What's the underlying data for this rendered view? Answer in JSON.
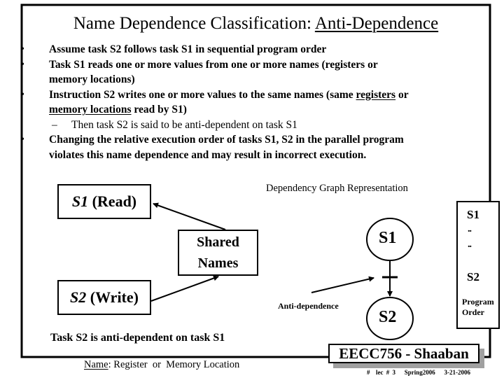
{
  "slide": {
    "title_prefix": "Name Dependence Classification: ",
    "title_emphasis": "Anti-Dependence",
    "bullets": [
      {
        "line1": "Assume  task S2 follows task S1 in sequential program order"
      },
      {
        "line1": "Task S1  reads one or more values from one or more names (registers or",
        "line2": "memory locations)"
      },
      {
        "line1_a": "Instruction  S2  writes one or more  values to the same  names (same ",
        "line1_u": "registers",
        "line1_b": " or",
        "line2_u": "memory locations",
        "line2_b": "  read by S1)",
        "sub": "Then task S2 is said to be anti-dependent on task S1"
      },
      {
        "line1": "Changing the relative execution order of tasks S1, S2  in the parallel program",
        "line2": "violates this name dependence and may result in  incorrect execution."
      }
    ],
    "bullet_glyph": "•",
    "sub_glyph": "–"
  },
  "diagram": {
    "s1_read": {
      "italic": "S1",
      "rest": " (Read)"
    },
    "s2_write": {
      "italic": "S2",
      "rest": " (Write)"
    },
    "shared_names": {
      "line1": "Shared",
      "line2": "Names"
    },
    "graph_title": "Dependency Graph Representation",
    "node_s1": "S1",
    "node_s2": "S2",
    "edge_label": "Anti-dependence",
    "program_order": {
      "first": "S1",
      "dots1": "..",
      "dots2": "..",
      "last": "S2",
      "label_line1": "Program",
      "label_line2": "Order"
    },
    "conclusion": "Task S2 is anti-dependent on task S1",
    "name_label": "Name",
    "name_rest": ": Register  or  Memory Location"
  },
  "footer": {
    "course": "EECC756 - Shaaban",
    "meta": "#  lec # 3   Spring2006   3-21-2006"
  },
  "colors": {
    "ink": "#000000",
    "background": "#ffffff",
    "shadow": "#a0a0a0"
  }
}
